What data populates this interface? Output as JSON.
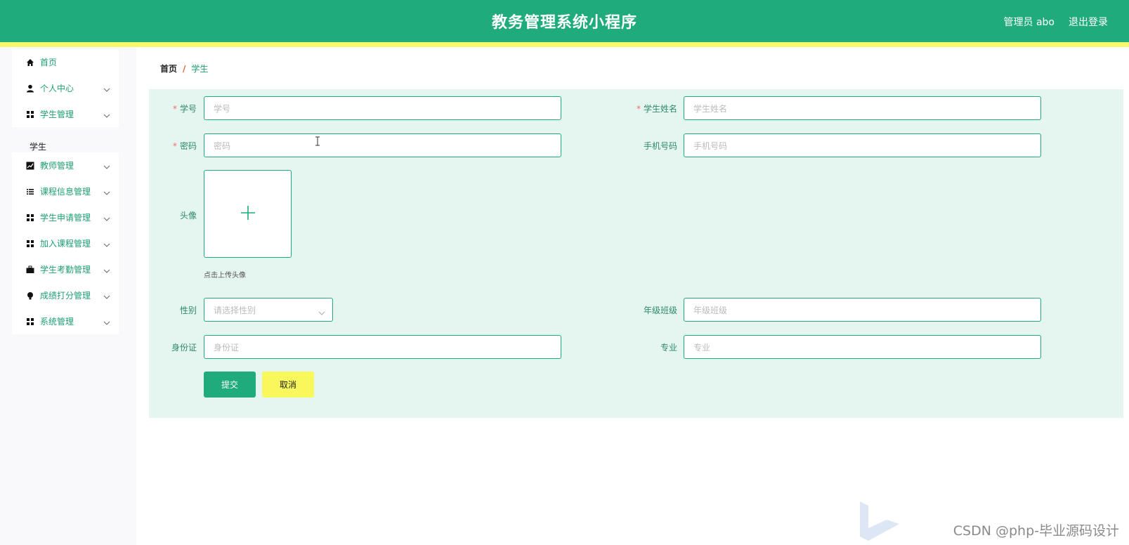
{
  "header": {
    "title": "教务管理系统小程序",
    "user": "管理员 abo",
    "logout": "退出登录",
    "bg_color": "#1fab7c",
    "accent_bar_color": "#f5f86a"
  },
  "sidebar": {
    "items": [
      {
        "label": "首页",
        "icon": "home-icon"
      },
      {
        "label": "个人中心",
        "icon": "user-icon"
      },
      {
        "label": "学生管理",
        "icon": "grid-icon",
        "expanded": true
      },
      {
        "label": "教师管理",
        "icon": "chart-icon"
      },
      {
        "label": "课程信息管理",
        "icon": "list-icon"
      },
      {
        "label": "学生申请管理",
        "icon": "grid-icon"
      },
      {
        "label": "加入课程管理",
        "icon": "grid-icon"
      },
      {
        "label": "学生考勤管理",
        "icon": "briefcase-icon"
      },
      {
        "label": "成绩打分管理",
        "icon": "bulb-icon"
      },
      {
        "label": "系统管理",
        "icon": "grid-icon"
      }
    ],
    "submenu": {
      "label": "学生"
    }
  },
  "breadcrumb": {
    "home": "首页",
    "separator": "/",
    "current": "学生"
  },
  "form": {
    "student_id": {
      "label": "学号",
      "placeholder": "学号",
      "required": true
    },
    "student_name": {
      "label": "学生姓名",
      "placeholder": "学生姓名",
      "required": true
    },
    "password": {
      "label": "密码",
      "placeholder": "密码",
      "required": true
    },
    "phone": {
      "label": "手机号码",
      "placeholder": "手机号码"
    },
    "avatar": {
      "label": "头像",
      "tip": "点击上传头像"
    },
    "gender": {
      "label": "性别",
      "placeholder": "请选择性别"
    },
    "grade_class": {
      "label": "年级班级",
      "placeholder": "年级班级"
    },
    "id_card": {
      "label": "身份证",
      "placeholder": "身份证"
    },
    "major": {
      "label": "专业",
      "placeholder": "专业"
    },
    "submit": "提交",
    "cancel": "取消",
    "required_mark": "*"
  },
  "watermark": "CSDN @php-毕业源码设计"
}
